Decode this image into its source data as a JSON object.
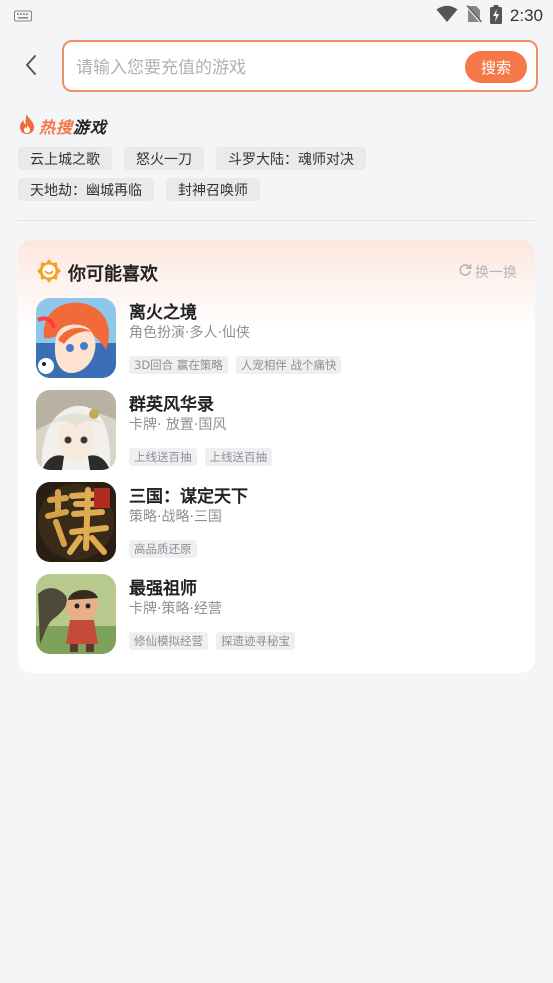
{
  "status_bar": {
    "time": "2:30",
    "icons": [
      "keyboard-icon",
      "wifi-icon",
      "no-sim-icon",
      "battery-charging-icon"
    ]
  },
  "search": {
    "placeholder": "请输入您要充值的游戏",
    "value": "",
    "button_label": "搜索"
  },
  "hot_search": {
    "title_part1": "热搜",
    "title_part2": "游戏",
    "tags_row1": [
      "云上城之歌",
      "怒火一刀",
      "斗罗大陆：魂师对决"
    ],
    "tags_row2": [
      "天地劫：幽城再临",
      "封神召唤师"
    ]
  },
  "recommend": {
    "title": "你可能喜欢",
    "refresh_label": "换一换",
    "games": [
      {
        "name": "离火之境",
        "category": "角色扮演·多人·仙侠",
        "tags": [
          "3D回合 赢在策略",
          "人宠相伴 战个痛快"
        ]
      },
      {
        "name": "群英风华录",
        "category": "卡牌· 放置·国风",
        "tags": [
          "上线送百抽",
          "上线送百抽"
        ]
      },
      {
        "name": "三国：谋定天下",
        "category": "策略·战略·三国",
        "tags": [
          "高品质还原"
        ]
      },
      {
        "name": "最强祖师",
        "category": "卡牌·策略·经营",
        "tags": [
          "修仙模拟经营",
          "探遗迹寻秘宝"
        ]
      }
    ]
  },
  "colors": {
    "accent": "#f47848",
    "search_border": "#f0906a",
    "background": "#f4f5f7"
  }
}
